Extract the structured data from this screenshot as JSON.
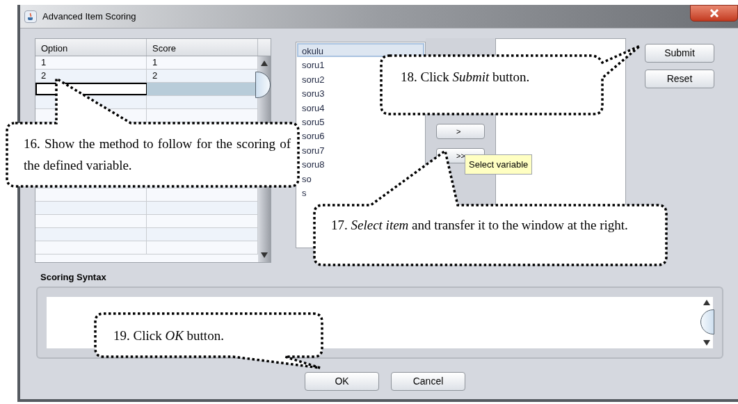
{
  "window": {
    "title": "Advanced Item Scoring"
  },
  "table": {
    "columns": [
      "Option",
      "Score"
    ],
    "rows": [
      {
        "cells": [
          "1",
          "1"
        ],
        "selected": false,
        "editing": false
      },
      {
        "cells": [
          "2",
          "2"
        ],
        "selected": false,
        "editing": false
      },
      {
        "selected": true,
        "editing": true
      }
    ]
  },
  "variable_list": [
    {
      "label": "okulu",
      "selected": true
    },
    {
      "label": "soru1",
      "selected": false
    },
    {
      "label": "soru2",
      "selected": false
    },
    {
      "label": "soru3",
      "selected": false
    },
    {
      "label": "soru4",
      "selected": false
    },
    {
      "label": "soru5",
      "selected": false
    },
    {
      "label": "soru6",
      "selected": false
    },
    {
      "label": "soru7",
      "selected": false
    },
    {
      "label": "soru8",
      "selected": false
    },
    {
      "label": "so",
      "selected": false
    },
    {
      "label": "s",
      "selected": false
    }
  ],
  "transfer_buttons": [
    ">",
    ">>"
  ],
  "tooltip": "Select variable",
  "side_buttons": [
    "Submit",
    "Reset"
  ],
  "scoring_syntax": {
    "label": "Scoring Syntax"
  },
  "dialog_buttons": [
    "OK",
    "Cancel"
  ],
  "callouts": [
    "16. Show the method to follow for the scoring of the defined variable.",
    "18. Click *Submit* button.",
    "17. *Select item* and transfer it to the window at the right.",
    "19. Click *OK* button."
  ]
}
